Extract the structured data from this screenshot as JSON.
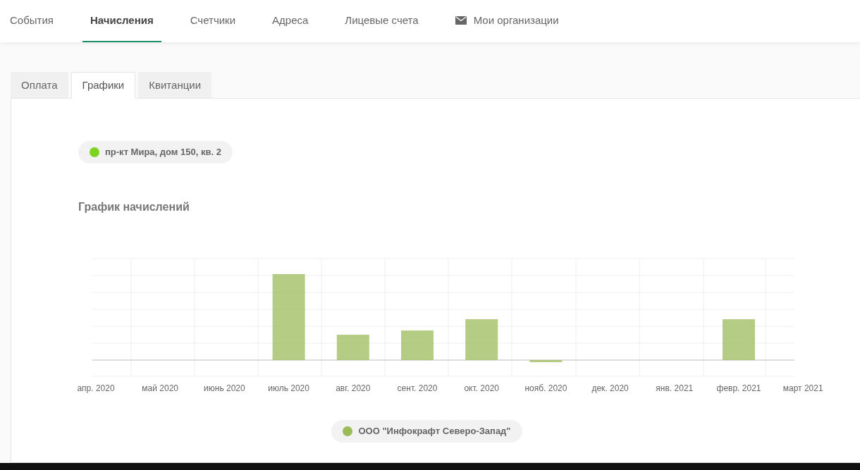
{
  "nav": [
    {
      "label": "События",
      "selected": false,
      "kind": "plain"
    },
    {
      "label": "Начисления",
      "selected": true,
      "kind": "plain"
    },
    {
      "label": "Счетчики",
      "selected": false,
      "kind": "plain"
    },
    {
      "label": "Адреса",
      "selected": false,
      "kind": "plain"
    },
    {
      "label": "Лицевые счета",
      "selected": false,
      "kind": "plain"
    },
    {
      "label": "Мои организации",
      "selected": false,
      "kind": "mail"
    }
  ],
  "tabs": [
    {
      "label": "Оплата",
      "selected": false
    },
    {
      "label": "Графики",
      "selected": true
    },
    {
      "label": "Квитанции",
      "selected": false
    }
  ],
  "address_chip": {
    "label": "пр-кт Мира, дом 150, кв. 2",
    "color": "#7ed321"
  },
  "chart": {
    "title": "График начислений",
    "month_labels": [
      "апр. 2020",
      "май 2020",
      "июнь 2020",
      "июль 2020",
      "авг. 2020",
      "сент. 2020",
      "окт. 2020",
      "нояб. 2020",
      "дек. 2020",
      "янв. 2021",
      "февр. 2021",
      "март 2021"
    ],
    "legend": {
      "label": "ООО \"Инфокрафт Северо-Запад\"",
      "color": "#9bbb59"
    }
  }
}
